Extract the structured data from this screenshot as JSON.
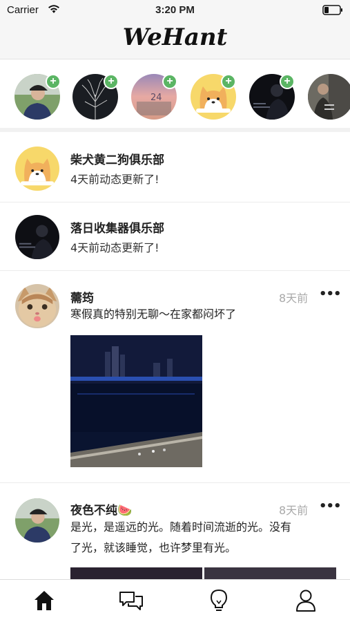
{
  "status_bar": {
    "carrier": "Carrier",
    "time": "3:20 PM",
    "icons": [
      "wifi-icon",
      "battery-icon"
    ]
  },
  "header": {
    "title": "WeHant"
  },
  "stories": [
    {
      "name": "story-1",
      "has_add": true
    },
    {
      "name": "story-2",
      "has_add": true
    },
    {
      "name": "story-3",
      "has_add": true,
      "overlay_text": "24"
    },
    {
      "name": "story-4",
      "has_add": true
    },
    {
      "name": "story-5",
      "has_add": true
    },
    {
      "name": "story-6",
      "has_add": false
    }
  ],
  "clubs": [
    {
      "name": "柴犬黄二狗俱乐部",
      "subtitle": "4天前动态更新了!"
    },
    {
      "name": "落日收集器俱乐部",
      "subtitle": "4天前动态更新了!"
    }
  ],
  "posts": [
    {
      "author": "薷筠",
      "time": "8天前",
      "more": "•••",
      "text": "寒假真的特别无聊～在家都闷坏了"
    },
    {
      "author": "夜色不纯🍉",
      "time": "8天前",
      "more": "•••",
      "text_line1": "是光，是遥远的光。随着时间流逝的光。没有",
      "text_line2": "了光，就该睡觉，也许梦里有光。"
    }
  ],
  "tab_bar": {
    "items": [
      "home-icon",
      "chat-icon",
      "lightbulb-icon",
      "profile-icon"
    ],
    "active": "home-icon"
  },
  "colors": {
    "accent_add": "#5bb564",
    "time_gray": "#a9a9a9"
  }
}
